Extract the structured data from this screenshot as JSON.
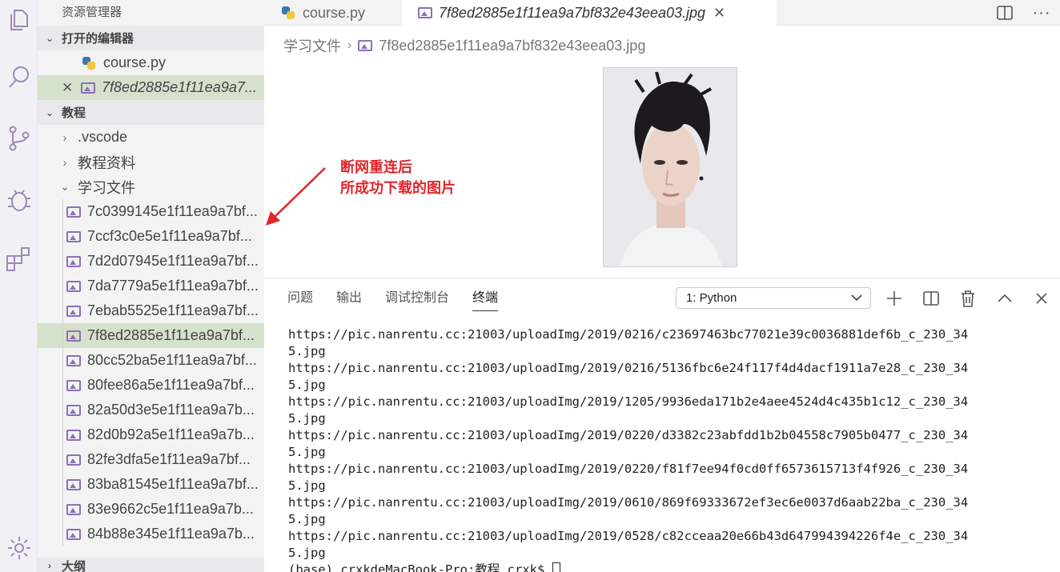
{
  "sidebar": {
    "title": "资源管理器",
    "open_editors": {
      "header": "打开的编辑器",
      "items": [
        "course.py",
        "7f8ed2885e1f11ea9a7..."
      ]
    },
    "workspace": {
      "header": "教程",
      "folders": [
        ".vscode",
        "教程资料",
        "学习文件"
      ],
      "files": [
        "7c0399145e1f11ea9a7bf...",
        "7ccf3c0e5e1f11ea9a7bf...",
        "7d2d07945e1f11ea9a7bf...",
        "7da7779a5e1f11ea9a7bf...",
        "7ebab5525e1f11ea9a7bf...",
        "7f8ed2885e1f11ea9a7bf...",
        "80cc52ba5e1f11ea9a7bf...",
        "80fee86a5e1f11ea9a7bf...",
        "82a50d3e5e1f11ea9a7b...",
        "82d0b92a5e1f11ea9a7b...",
        "82fe3dfa5e1f11ea9a7bf...",
        "83ba81545e1f11ea9a7bf...",
        "83e9662c5e1f11ea9a7b...",
        "84b88e345e1f11ea9a7b..."
      ],
      "selected_file": "7f8ed2885e1f11ea9a7bf..."
    },
    "outline_header": "大纲"
  },
  "tabs": [
    {
      "label": "course.py",
      "active": false
    },
    {
      "label": "7f8ed2885e1f11ea9a7bf832e43eea03.jpg",
      "active": true
    }
  ],
  "breadcrumb": {
    "folder": "学习文件",
    "file": "7f8ed2885e1f11ea9a7bf832e43eea03.jpg"
  },
  "annotation": {
    "line1": "断网重连后",
    "line2": "所成功下载的图片",
    "color": "#e0262a"
  },
  "panel": {
    "tabs": [
      "问题",
      "输出",
      "调试控制台",
      "终端"
    ],
    "active_tab": "终端",
    "terminal_select": "1: Python",
    "terminal_lines": [
      "https://pic.nanrentu.cc:21003/uploadImg/2019/0216/c23697463bc77021e39c0036881def6b_c_230_34",
      "5.jpg",
      "https://pic.nanrentu.cc:21003/uploadImg/2019/0216/5136fbc6e24f117f4d4dacf1911a7e28_c_230_34",
      "5.jpg",
      "https://pic.nanrentu.cc:21003/uploadImg/2019/1205/9936eda171b2e4aee4524d4c435b1c12_c_230_34",
      "5.jpg",
      "https://pic.nanrentu.cc:21003/uploadImg/2019/0220/d3382c23abfdd1b2b04558c7905b0477_c_230_34",
      "5.jpg",
      "https://pic.nanrentu.cc:21003/uploadImg/2019/0220/f81f7ee94f0cd0ff6573615713f4f926_c_230_34",
      "5.jpg",
      "https://pic.nanrentu.cc:21003/uploadImg/2019/0610/869f69333672ef3ec6e0037d6aab22ba_c_230_34",
      "5.jpg",
      "https://pic.nanrentu.cc:21003/uploadImg/2019/0528/c82cceaa20e66b43d647994394226f4e_c_230_34",
      "5.jpg"
    ],
    "prompt": "(base) crxkdeMacBook-Pro:教程 crxk$ "
  },
  "icons": {
    "explorer": "files-icon",
    "search": "search-icon",
    "scm": "source-control-icon",
    "debug": "debug-icon",
    "extensions": "extensions-icon",
    "settings": "gear-icon"
  },
  "colors": {
    "selection": "#d6e1cc",
    "image_icon": "#8d6fb8",
    "accent_icons": "#9b8ab8"
  }
}
